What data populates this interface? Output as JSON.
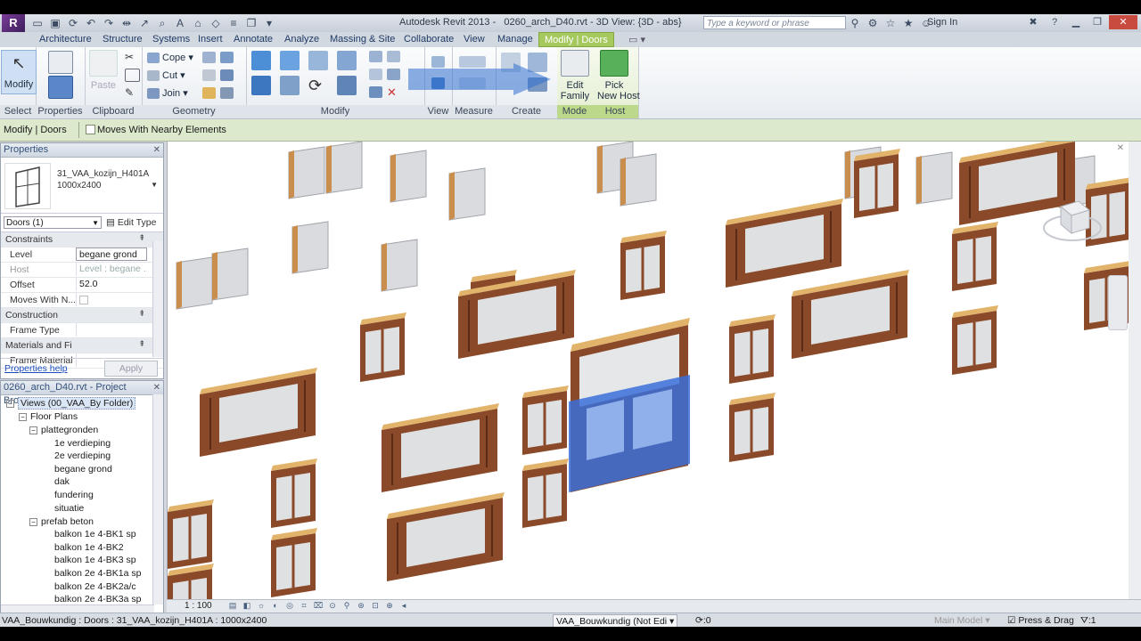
{
  "window": {
    "title": "Autodesk Revit 2013 -",
    "document": "0260_arch_D40.rvt - 3D View: {3D - abs}",
    "search_placeholder": "Type a keyword or phrase",
    "sign_in": "Sign In"
  },
  "ribbon": {
    "tabs": [
      {
        "label": "Architecture"
      },
      {
        "label": "Structure"
      },
      {
        "label": "Systems"
      },
      {
        "label": "Insert"
      },
      {
        "label": "Annotate"
      },
      {
        "label": "Analyze"
      },
      {
        "label": "Massing & Site"
      },
      {
        "label": "Collaborate"
      },
      {
        "label": "View"
      },
      {
        "label": "Manage"
      },
      {
        "label": "Modify | Doors"
      }
    ],
    "panels": {
      "select": "Select",
      "properties": "Properties",
      "clipboard": "Clipboard",
      "geometry": "Geometry",
      "modify": "Modify",
      "view": "View",
      "measure": "Measure",
      "create": "Create",
      "mode": "Mode",
      "host": "Host"
    },
    "buttons": {
      "modify": "Modify",
      "paste": "Paste",
      "cope": "Cope",
      "cut": "Cut",
      "join": "Join",
      "edit_family_1": "Edit",
      "edit_family_2": "Family",
      "pick_host_1": "Pick",
      "pick_host_2": "New Host"
    }
  },
  "options_bar": {
    "context": "Modify | Doors",
    "checkbox_label": "Moves With Nearby Elements"
  },
  "properties": {
    "title": "Properties",
    "type_name_1": "31_VAA_kozijn_H401A",
    "type_name_2": "1000x2400",
    "filter": "Doors (1)",
    "edit_type": "Edit Type",
    "rows": [
      {
        "key": "Constraints",
        "section": true
      },
      {
        "key": "Level",
        "value": "begane grond"
      },
      {
        "key": "Host",
        "value": "Level : begane ..."
      },
      {
        "key": "Offset",
        "value": "52.0"
      },
      {
        "key": "Moves With N..."
      },
      {
        "key": "Construction",
        "section": true
      },
      {
        "key": "Frame Type"
      },
      {
        "key": "Materials and Fi...",
        "section": true
      },
      {
        "key": "Frame Material"
      }
    ],
    "help": "Properties help",
    "apply": "Apply"
  },
  "project_browser": {
    "title": "0260_arch_D40.rvt - Project Browser",
    "nodes": [
      {
        "label": "Views (00_VAA_By Folder)"
      },
      {
        "label": "Floor Plans"
      },
      {
        "label": "plattegronden"
      },
      {
        "label": "1e verdieping"
      },
      {
        "label": "2e verdieping"
      },
      {
        "label": "begane grond"
      },
      {
        "label": "dak"
      },
      {
        "label": "fundering"
      },
      {
        "label": "situatie"
      },
      {
        "label": "prefab beton"
      },
      {
        "label": "balkon 1e 4-BK1 sp"
      },
      {
        "label": "balkon 1e 4-BK2"
      },
      {
        "label": "balkon 1e 4-BK3 sp"
      },
      {
        "label": "balkon 2e 4-BK1a sp"
      },
      {
        "label": "balkon 2e 4-BK2a/c"
      },
      {
        "label": "balkon 2e 4-BK3a sp"
      }
    ]
  },
  "view_control": {
    "scale": "1 : 100"
  },
  "status": {
    "text": "VAA_Bouwkundig : Doors : 31_VAA_kozijn_H401A : 1000x2400",
    "workset": "VAA_Bouwkundig (Not Edi",
    "zero": ":0",
    "model": "Main Model",
    "press_drag": "Press & Drag",
    "filter_count": ":1"
  },
  "colors": {
    "context_tab": "#a6c95e",
    "selection": "#3a6fd8",
    "frame": "#8a4a2a",
    "sill": "#e2b36b"
  }
}
